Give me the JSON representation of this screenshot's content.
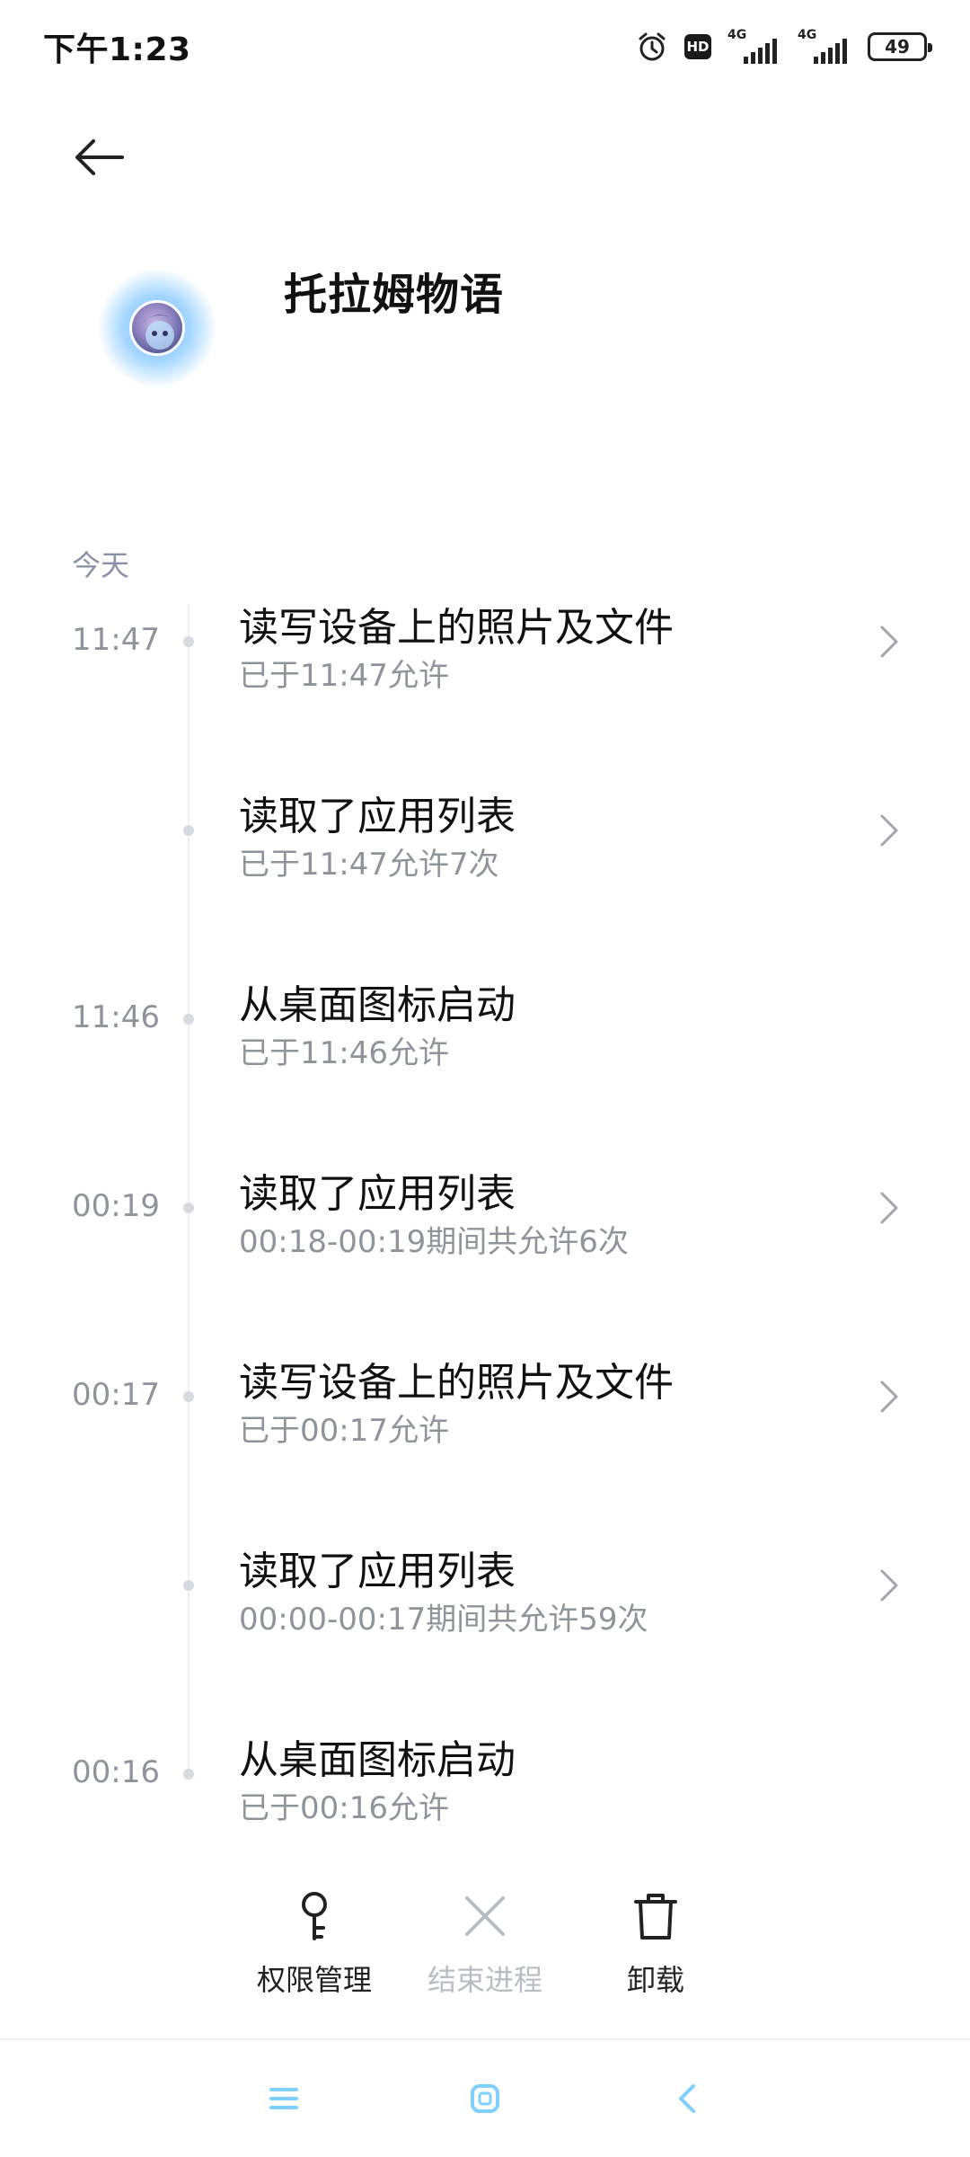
{
  "status_bar": {
    "time": "下午1:23",
    "icons": [
      "alarm-icon",
      "hd-icon",
      "signal-4g-icon",
      "signal-4g-icon",
      "battery-icon"
    ],
    "hd_label": "HD",
    "network_label_1": "4G",
    "network_label_2": "4G",
    "battery_level": "49"
  },
  "header": {
    "back_icon": "back-arrow-icon",
    "app_name": "托拉姆物语"
  },
  "timeline": {
    "section_label": "今天",
    "entries": [
      {
        "time": "11:47",
        "title": "读写设备上的照片及文件",
        "subtitle": "已于11:47允许",
        "has_chevron": true
      },
      {
        "time": "",
        "title": "读取了应用列表",
        "subtitle": "已于11:47允许7次",
        "has_chevron": true
      },
      {
        "time": "11:46",
        "title": "从桌面图标启动",
        "subtitle": "已于11:46允许",
        "has_chevron": false
      },
      {
        "time": "00:19",
        "title": "读取了应用列表",
        "subtitle": "00:18-00:19期间共允许6次",
        "has_chevron": true
      },
      {
        "time": "00:17",
        "title": "读写设备上的照片及文件",
        "subtitle": "已于00:17允许",
        "has_chevron": true
      },
      {
        "time": "",
        "title": "读取了应用列表",
        "subtitle": "00:00-00:17期间共允许59次",
        "has_chevron": true
      },
      {
        "time": "00:16",
        "title": "从桌面图标启动",
        "subtitle": "已于00:16允许",
        "has_chevron": false
      }
    ]
  },
  "actions": {
    "permissions_label": "权限管理",
    "end_process_label": "结束进程",
    "uninstall_label": "卸载"
  },
  "nav_bar": {
    "menu_icon": "menu-icon",
    "home_icon": "home-icon",
    "back_icon": "nav-back-icon"
  },
  "colors": {
    "text_primary": "#111111",
    "text_secondary": "#8f949c",
    "section_label": "#8a93a6",
    "disabled": "#b8bcc4",
    "nav_accent": "#7fd0ff",
    "icon_glow": "#78c8ff"
  }
}
